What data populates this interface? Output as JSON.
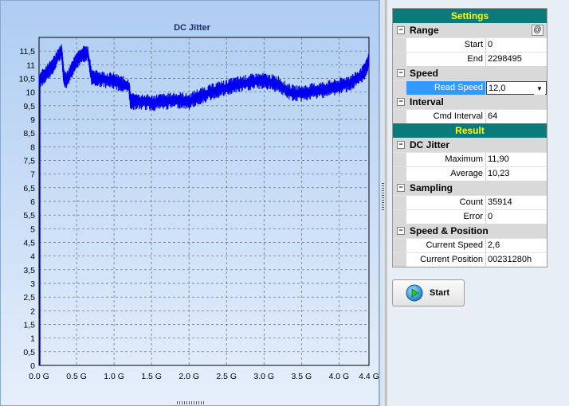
{
  "chart_data": {
    "type": "line",
    "title": "DC Jitter",
    "xlabel": "",
    "ylabel": "",
    "xlim": [
      0,
      4.4
    ],
    "ylim": [
      0,
      12
    ],
    "x_ticks": [
      "0.0 G",
      "0.5 G",
      "1.0 G",
      "1.5 G",
      "2.0 G",
      "2.5 G",
      "3.0 G",
      "3.5 G",
      "4.0 G",
      "4.4 G"
    ],
    "y_ticks": [
      "0",
      "0,5",
      "1",
      "1,5",
      "2",
      "2,5",
      "3",
      "3,5",
      "4",
      "4,5",
      "5",
      "5,5",
      "6",
      "6,5",
      "7",
      "7,5",
      "8",
      "8,5",
      "9",
      "9,5",
      "10",
      "10,5",
      "11",
      "11,5"
    ],
    "grid": true,
    "series": [
      {
        "color": "#0000ee",
        "x": [
          0.0,
          0.05,
          0.1,
          0.15,
          0.2,
          0.25,
          0.3,
          0.33,
          0.36,
          0.4,
          0.45,
          0.5,
          0.55,
          0.6,
          0.65,
          0.7,
          0.75,
          0.8,
          0.9,
          1.0,
          1.1,
          1.2,
          1.22,
          1.3,
          1.4,
          1.5,
          1.6,
          1.7,
          1.8,
          1.9,
          2.0,
          2.1,
          2.2,
          2.3,
          2.4,
          2.5,
          2.6,
          2.7,
          2.8,
          2.9,
          3.0,
          3.1,
          3.2,
          3.3,
          3.4,
          3.5,
          3.6,
          3.7,
          3.8,
          3.9,
          4.0,
          4.1,
          4.2,
          4.3,
          4.35,
          4.4
        ],
        "y": [
          10.4,
          10.55,
          10.7,
          10.85,
          11.05,
          11.3,
          11.55,
          10.55,
          10.4,
          10.6,
          10.9,
          11.15,
          11.3,
          11.4,
          11.45,
          10.55,
          10.5,
          10.5,
          10.45,
          10.4,
          10.3,
          10.2,
          9.65,
          9.65,
          9.65,
          9.6,
          9.65,
          9.65,
          9.7,
          9.7,
          9.65,
          9.8,
          9.9,
          10.0,
          10.1,
          10.15,
          10.25,
          10.3,
          10.35,
          10.4,
          10.4,
          10.35,
          10.3,
          10.05,
          9.95,
          9.95,
          10.0,
          10.05,
          10.1,
          10.15,
          10.2,
          10.3,
          10.4,
          10.6,
          10.8,
          11.15
        ],
        "band": 0.22
      }
    ]
  },
  "settings": {
    "header": "Settings",
    "range": {
      "label": "Range",
      "at_label": "@",
      "start_label": "Start",
      "start_value": "0",
      "end_label": "End",
      "end_value": "2298495"
    },
    "speed": {
      "label": "Speed",
      "read_speed_label": "Read Speed",
      "read_speed_value": "12,0"
    },
    "interval": {
      "label": "Interval",
      "cmd_interval_label": "Cmd Interval",
      "cmd_interval_value": "64"
    }
  },
  "result": {
    "header": "Result",
    "dc_jitter": {
      "label": "DC Jitter",
      "maximum_label": "Maximum",
      "maximum_value": "11,90",
      "average_label": "Average",
      "average_value": "10,23"
    },
    "sampling": {
      "label": "Sampling",
      "count_label": "Count",
      "count_value": "35914",
      "error_label": "Error",
      "error_value": "0"
    },
    "speed_position": {
      "label": "Speed & Position",
      "current_speed_label": "Current Speed",
      "current_speed_value": "2,6",
      "current_position_label": "Current Position",
      "current_position_value": "00231280h"
    }
  },
  "toggle_glyph": "−",
  "dropdown_glyph": "▼",
  "start_button": {
    "label": "Start",
    "icon": "play-icon"
  }
}
